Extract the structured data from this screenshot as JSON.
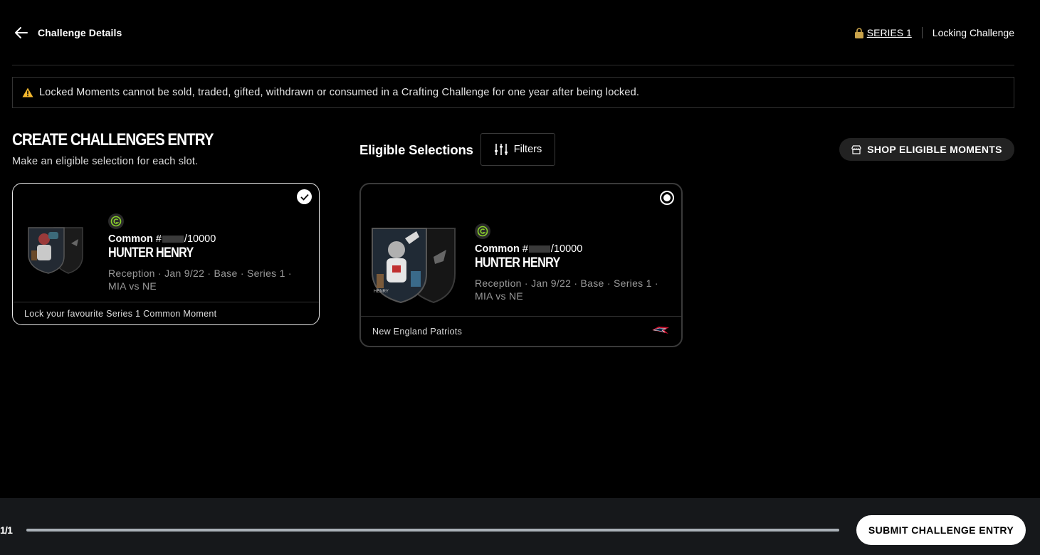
{
  "header": {
    "title": "Challenge Details",
    "series_link": "SERIES 1",
    "challenge_type": "Locking Challenge"
  },
  "warning": {
    "text": "Locked Moments cannot be sold, traded, gifted, withdrawn or consumed in a Crafting Challenge for one year after being locked."
  },
  "create": {
    "heading": "CREATE CHALLENGES ENTRY",
    "subtitle": "Make an eligible selection for each slot."
  },
  "slot_card": {
    "tier": "Common",
    "serial_prefix": "#",
    "serial_total": "/10000",
    "player": "HUNTER HENRY",
    "meta_line1": "Reception · Jan 9/22 · Base · Series 1 ·",
    "meta_line2": "MIA vs NE",
    "footer": "Lock your favourite Series 1 Common Moment",
    "selected": true
  },
  "eligible": {
    "heading": "Eligible Selections",
    "filters_label": "Filters",
    "shop_label": "SHOP ELIGIBLE MOMENTS",
    "cards": [
      {
        "tier": "Common",
        "serial_prefix": "#",
        "serial_total": "/10000",
        "player": "HUNTER HENRY",
        "meta_line1": "Reception · Jan 9/22 · Base · Series 1 ·",
        "meta_line2": "MIA vs NE",
        "team": "New England Patriots",
        "selected": true
      }
    ]
  },
  "footer": {
    "count": "1/1",
    "progress": 1.0,
    "submit_label": "SUBMIT CHALLENGE ENTRY"
  },
  "colors": {
    "background": "#000000",
    "footer_bg": "#16181b",
    "warning_icon": "#f5b82e",
    "badge_green": "#8bd22b"
  }
}
